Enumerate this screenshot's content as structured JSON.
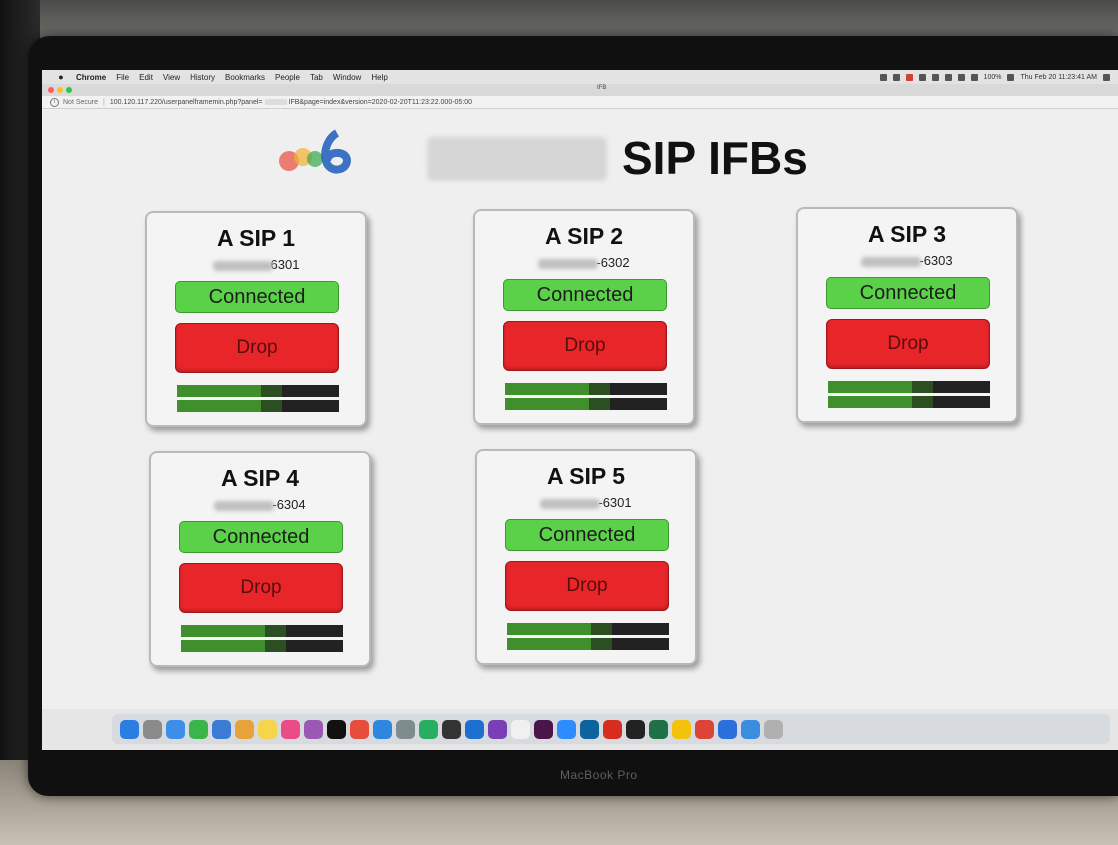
{
  "menubar": {
    "app_name": "Chrome",
    "items": [
      "File",
      "Edit",
      "View",
      "History",
      "Bookmarks",
      "People",
      "Tab",
      "Window",
      "Help"
    ],
    "battery": "100%",
    "clock": "Thu Feb 20  11:23:41 AM"
  },
  "browser": {
    "tab_title": "IFB",
    "security_label": "Not Secure",
    "url": "100.120.117.220/userpanelframemin.php?panel=",
    "url_suffix": "IFB&page=index&version=2020-02-20T11:23:22.000-05:00"
  },
  "page": {
    "title": "SIP IFBs",
    "cards": [
      {
        "name": "A SIP 1",
        "phone_suffix": "6301",
        "status": "Connected",
        "action": "Drop",
        "meter_levels": [
          0.52,
          0.52
        ]
      },
      {
        "name": "A SIP 2",
        "phone_suffix": "-6302",
        "status": "Connected",
        "action": "Drop",
        "meter_levels": [
          0.52,
          0.52
        ]
      },
      {
        "name": "A SIP 3",
        "phone_suffix": "-6303",
        "status": "Connected",
        "action": "Drop",
        "meter_levels": [
          0.52,
          0.52
        ]
      },
      {
        "name": "A SIP 4",
        "phone_suffix": "-6304",
        "status": "Connected",
        "action": "Drop",
        "meter_levels": [
          0.52,
          0.52
        ]
      },
      {
        "name": "A SIP 5",
        "phone_suffix": "-6301",
        "status": "Connected",
        "action": "Drop",
        "meter_levels": [
          0.52,
          0.52
        ]
      }
    ]
  },
  "device": {
    "label": "MacBook Pro"
  },
  "colors": {
    "connected": "#5bd14a",
    "drop": "#e8262a",
    "meter_active": "#3f8f2c"
  }
}
